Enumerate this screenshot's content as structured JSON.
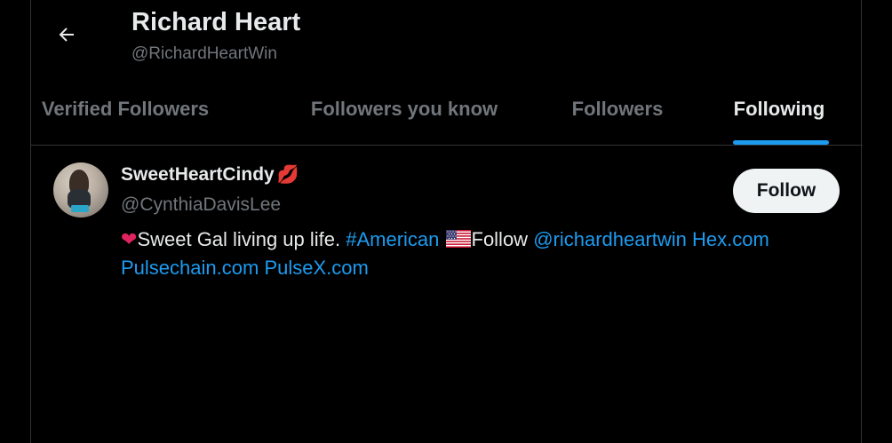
{
  "header": {
    "title": "Richard Heart",
    "handle": "@RichardHeartWin"
  },
  "tabs": [
    {
      "label": "Verified Followers",
      "active": false
    },
    {
      "label": "Followers you know",
      "active": false
    },
    {
      "label": "Followers",
      "active": false
    },
    {
      "label": "Following",
      "active": true
    }
  ],
  "users": [
    {
      "display_name": "SweetHeartCindy",
      "name_emoji": "💋",
      "handle": "@CynthiaDavisLee",
      "follow_label": "Follow",
      "bio": {
        "heart": "❤",
        "text1": "Sweet Gal living up life. ",
        "hashtag": "#American",
        "text2": "Follow ",
        "mention": "@richardheartwin",
        "link1": "Hex.com",
        "link2": "Pulsechain.com",
        "link3": "PulseX.com"
      }
    }
  ],
  "colors": {
    "background": "#000000",
    "accent": "#1d9bf0",
    "text_primary": "#e7e9ea",
    "text_secondary": "#71767b",
    "divider": "#2f3336"
  },
  "icons": {
    "back": "arrow-left-icon",
    "lips": "kiss-mark-icon",
    "heart": "red-heart-icon",
    "flag": "us-flag-icon"
  }
}
